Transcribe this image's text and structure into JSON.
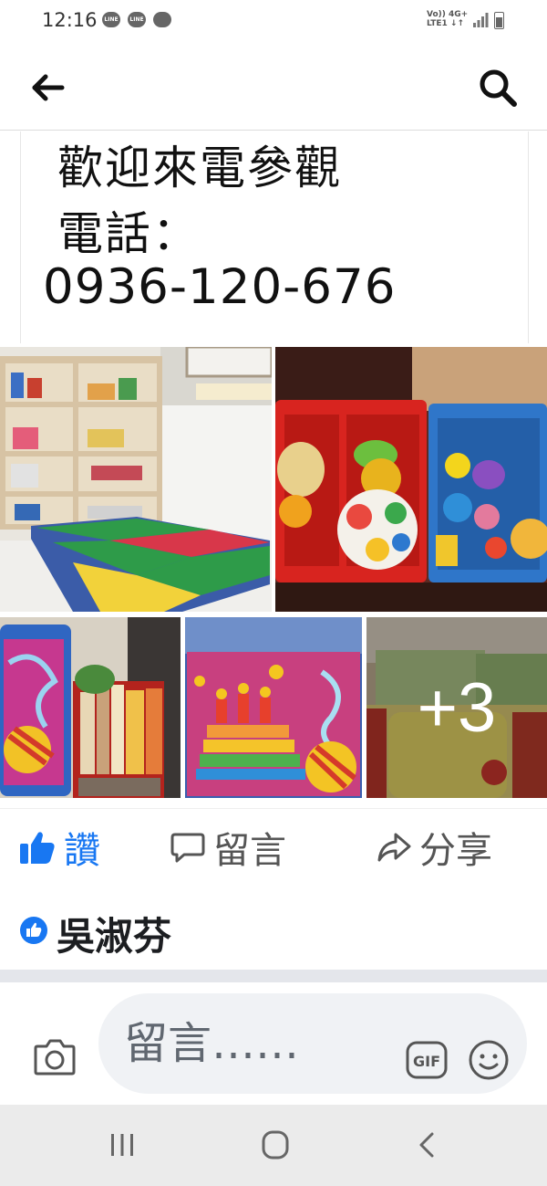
{
  "status_bar": {
    "time": "12:16",
    "app_icons": [
      "LINE",
      "LINE",
      "chat-bubble"
    ],
    "net_line1": "Vo)) 4G+",
    "net_line2": "LTE1 ↓↑"
  },
  "top_bar": {
    "back_icon": "arrow-left-icon",
    "search_icon": "search-icon"
  },
  "post_text": {
    "line1": "歡迎來電參觀",
    "line2": "電話：",
    "line3": "0936-120-676"
  },
  "photos": {
    "more_count_label": "+3"
  },
  "actions": {
    "like_label": "讚",
    "comment_label": "留言",
    "share_label": "分享",
    "like_color": "#1877f2"
  },
  "reactions": {
    "name": "吳淑芬"
  },
  "comment_bar": {
    "placeholder": "留言……",
    "gif_label": "GIF"
  },
  "nav_bar": {
    "recent_icon": "recent-apps-icon",
    "home_icon": "home-icon",
    "back_icon": "back-chevron-icon"
  }
}
